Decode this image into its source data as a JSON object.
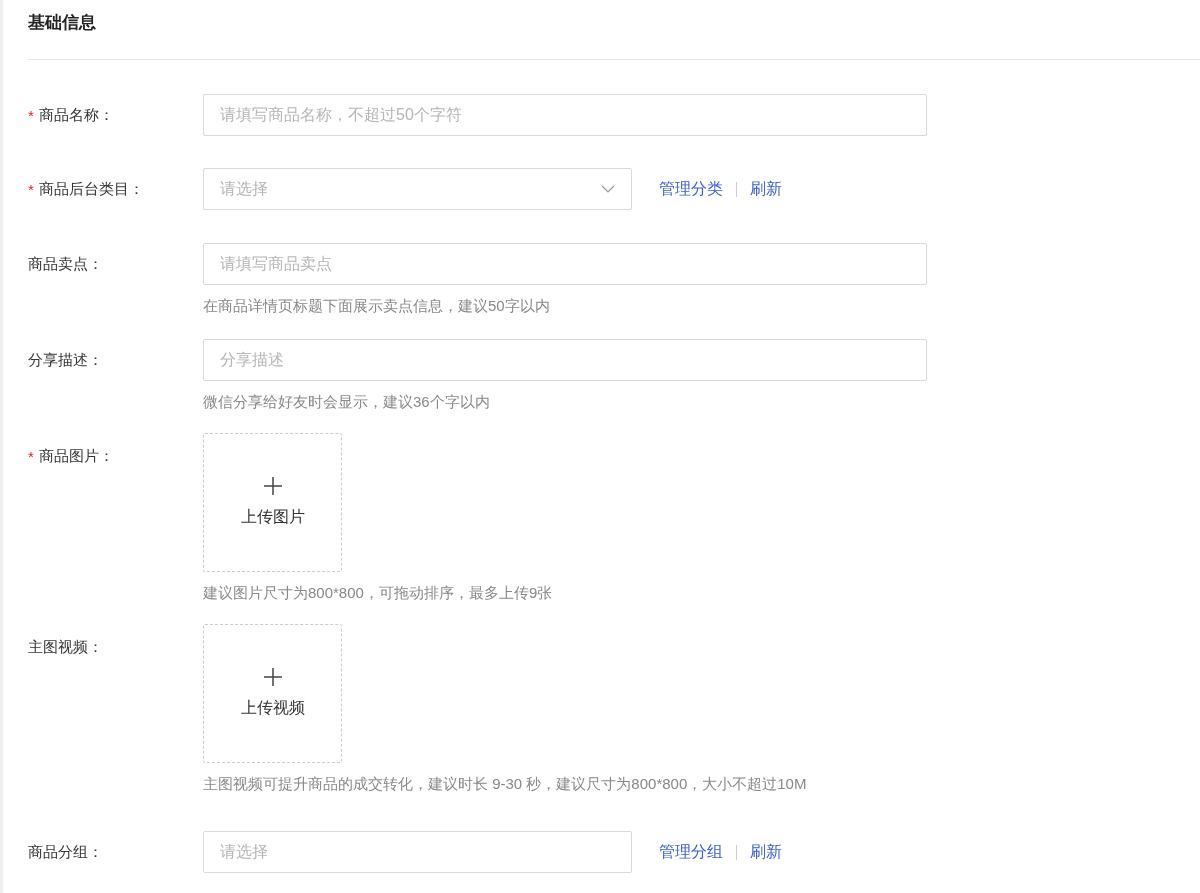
{
  "section_title": "基础信息",
  "fields": [
    {
      "kind": "input",
      "label": "商品名称：",
      "required_mark": "*",
      "placeholder": "请填写商品名称，不超过50个字符"
    },
    {
      "kind": "select",
      "label": "商品后台类目：",
      "required_mark": "*",
      "placeholder": "请选择",
      "caret": true,
      "links": [
        "管理分类",
        "刷新"
      ]
    },
    {
      "kind": "input",
      "label": "商品卖点：",
      "placeholder": "请填写商品卖点",
      "hint": "在商品详情页标题下面展示卖点信息，建议50字以内"
    },
    {
      "kind": "input",
      "label": "分享描述：",
      "placeholder": "分享描述",
      "hint": "微信分享给好友时会显示，建议36个字以内"
    },
    {
      "kind": "upload",
      "label": "商品图片：",
      "required_mark": "*",
      "button": "上传图片",
      "hint": "建议图片尺寸为800*800，可拖动排序，最多上传9张"
    },
    {
      "kind": "upload",
      "label": "主图视频：",
      "button": "上传视频",
      "hint": "主图视频可提升商品的成交转化，建议时长 9-30 秒，建议尺寸为800*800，大小不超过10M"
    },
    {
      "kind": "select",
      "label": "商品分组：",
      "placeholder": "请选择",
      "caret": false,
      "links": [
        "管理分组",
        "刷新"
      ]
    }
  ]
}
